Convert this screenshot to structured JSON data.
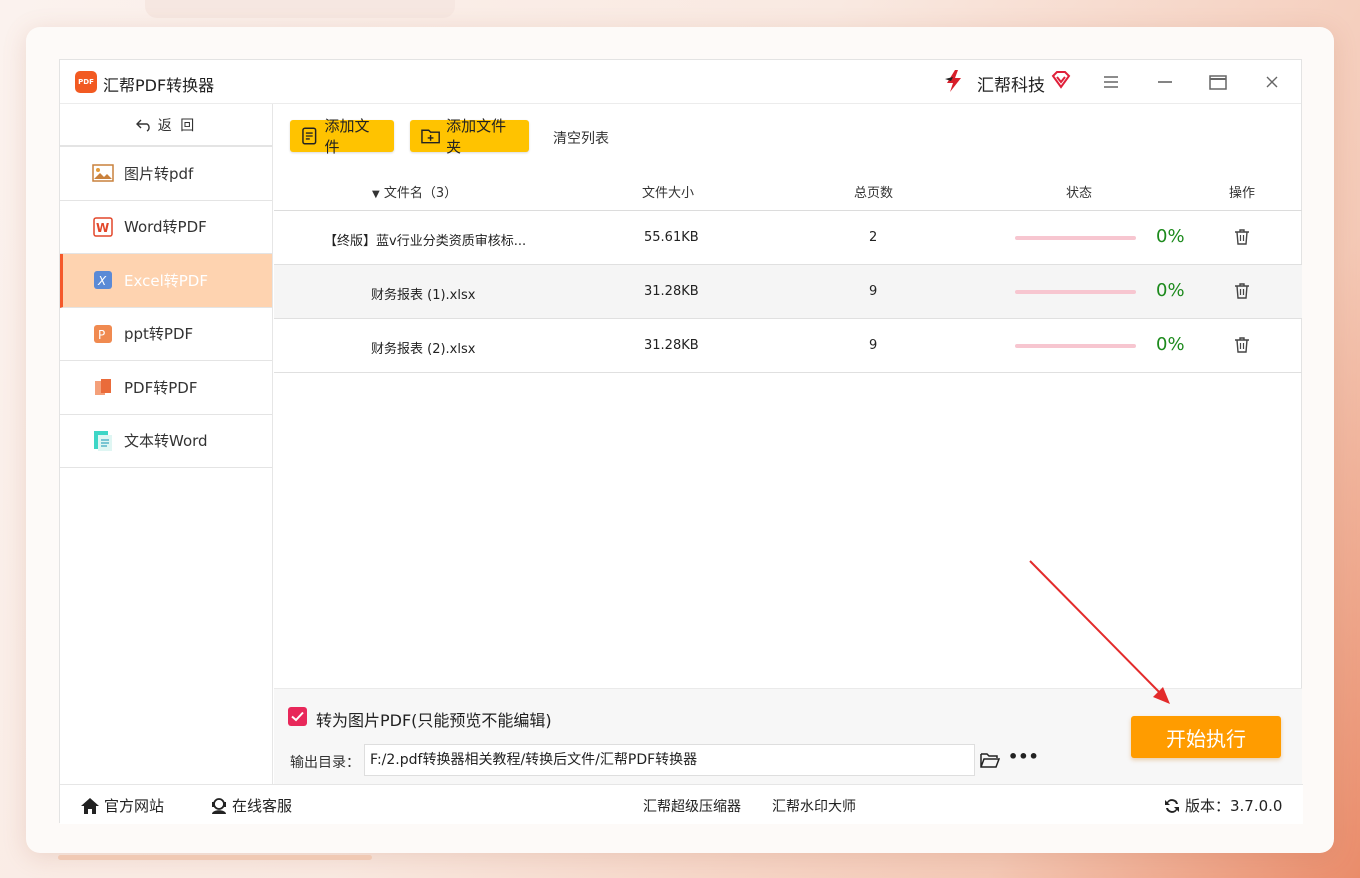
{
  "app": {
    "title": "汇帮PDF转换器",
    "logo_text": "PDF",
    "brand": "汇帮科技"
  },
  "sidebar": {
    "back_label": "返 回",
    "items": [
      {
        "label": "图片转pdf",
        "icon": "image-icon"
      },
      {
        "label": "Word转PDF",
        "icon": "word-icon"
      },
      {
        "label": "Excel转PDF",
        "icon": "excel-icon",
        "active": true
      },
      {
        "label": "ppt转PDF",
        "icon": "ppt-icon"
      },
      {
        "label": "PDF转PDF",
        "icon": "pdf-icon"
      },
      {
        "label": "文本转Word",
        "icon": "text-icon"
      }
    ]
  },
  "toolbar": {
    "add_file": "添加文件",
    "add_folder": "添加文件夹",
    "clear": "清空列表"
  },
  "table": {
    "headers": {
      "name": "文件名（3）",
      "size": "文件大小",
      "pages": "总页数",
      "status": "状态",
      "action": "操作"
    },
    "rows": [
      {
        "name": "【终版】蓝v行业分类资质审核标...",
        "size": "55.61KB",
        "pages": "2",
        "progress": "0%"
      },
      {
        "name": "财务报表 (1).xlsx",
        "size": "31.28KB",
        "pages": "9",
        "progress": "0%"
      },
      {
        "name": "财务报表 (2).xlsx",
        "size": "31.28KB",
        "pages": "9",
        "progress": "0%"
      }
    ]
  },
  "options": {
    "to_image_pdf": "转为图片PDF(只能预览不能编辑)",
    "to_image_pdf_checked": true,
    "output_label": "输出目录：",
    "output_path": "F:/2.pdf转换器相关教程/转换后文件/汇帮PDF转换器",
    "more": "•••"
  },
  "start_button": "开始执行",
  "footer": {
    "official_site": "官方网站",
    "support": "在线客服",
    "compressor": "汇帮超级压缩器",
    "watermark": "汇帮水印大师",
    "version": "版本：3.7.0.0"
  },
  "colors": {
    "accent": "#ff9c00",
    "active_nav": "#fed3b0",
    "button_yellow": "#ffc300",
    "progress_text": "#1c8a1c",
    "checkbox": "#e8285a"
  }
}
